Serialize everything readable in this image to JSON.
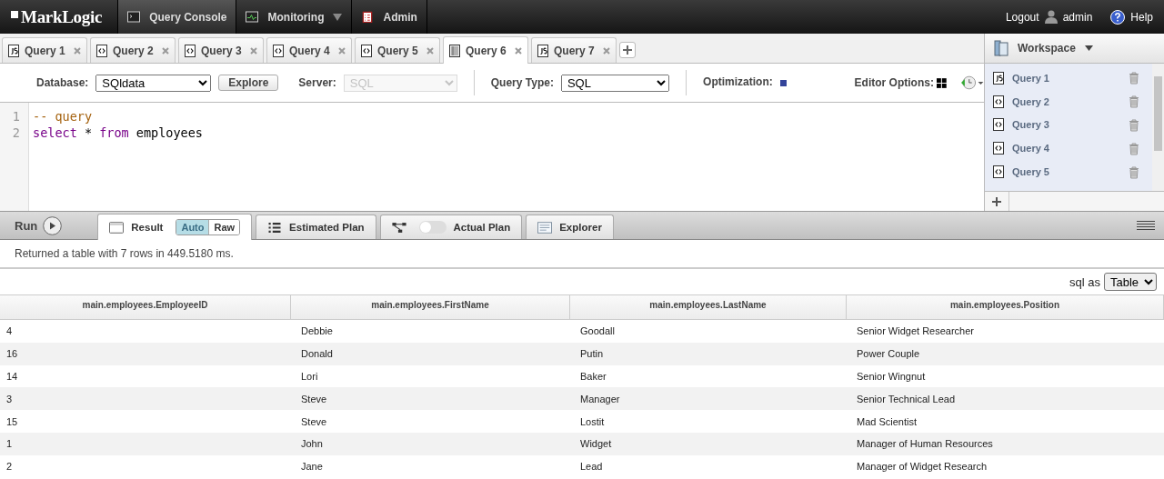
{
  "nav": {
    "logo": "MarkLogic",
    "items": [
      {
        "label": "Query Console",
        "selected": true,
        "dropdown": false
      },
      {
        "label": "Monitoring",
        "selected": false,
        "dropdown": true
      },
      {
        "label": "Admin",
        "selected": false,
        "dropdown": false
      }
    ],
    "logout": "Logout",
    "user": "admin",
    "help": "Help"
  },
  "query_tabs": [
    {
      "label": "Query 1",
      "kind": "js",
      "selected": false
    },
    {
      "label": "Query 2",
      "kind": "xquery",
      "selected": false
    },
    {
      "label": "Query 3",
      "kind": "xquery",
      "selected": false
    },
    {
      "label": "Query 4",
      "kind": "xquery",
      "selected": false
    },
    {
      "label": "Query 5",
      "kind": "xquery",
      "selected": false
    },
    {
      "label": "Query 6",
      "kind": "sql",
      "selected": true
    },
    {
      "label": "Query 7",
      "kind": "js",
      "selected": false
    }
  ],
  "toolbar": {
    "database": {
      "label": "Database:",
      "value": "SQldata"
    },
    "explore": "Explore",
    "server": {
      "label": "Server:",
      "value": "SQL",
      "disabled": true
    },
    "query_type": {
      "label": "Query Type:",
      "value": "SQL"
    },
    "optimization": {
      "label": "Optimization:"
    },
    "editor_options": {
      "label": "Editor Options:"
    }
  },
  "editor": {
    "lines": [
      {
        "number": "1",
        "tokens": [
          {
            "kind": "comment",
            "text": "-- query"
          }
        ]
      },
      {
        "number": "2",
        "tokens": [
          {
            "kind": "keyword",
            "text": "select"
          },
          {
            "kind": "plain",
            "text": " * "
          },
          {
            "kind": "keyword",
            "text": "from"
          },
          {
            "kind": "plain",
            "text": " employees"
          }
        ]
      }
    ]
  },
  "workspace": {
    "title": "Workspace",
    "items": [
      {
        "label": "Query 1",
        "kind": "js"
      },
      {
        "label": "Query 2",
        "kind": "xquery"
      },
      {
        "label": "Query 3",
        "kind": "xquery"
      },
      {
        "label": "Query 4",
        "kind": "xquery"
      },
      {
        "label": "Query 5",
        "kind": "xquery"
      }
    ]
  },
  "results": {
    "run": "Run",
    "tabs": [
      {
        "label": "Result",
        "kind": "result",
        "selected": true,
        "modes": [
          {
            "label": "Auto",
            "selected": true
          },
          {
            "label": "Raw",
            "selected": false
          }
        ]
      },
      {
        "label": "Estimated Plan",
        "kind": "estimated",
        "selected": false
      },
      {
        "label": "Actual Plan",
        "kind": "actual",
        "selected": false,
        "on": false
      },
      {
        "label": "Explorer",
        "kind": "explorer",
        "selected": false
      }
    ],
    "status": "Returned a table with 7 rows in 449.5180 ms.",
    "format": {
      "label": "sql as",
      "value": "Table"
    },
    "table": {
      "columns": [
        "main.employees.EmployeeID",
        "main.employees.FirstName",
        "main.employees.LastName",
        "main.employees.Position"
      ],
      "rows": [
        [
          "4",
          "Debbie",
          "Goodall",
          "Senior Widget Researcher"
        ],
        [
          "16",
          "Donald",
          "Putin",
          "Power Couple"
        ],
        [
          "14",
          "Lori",
          "Baker",
          "Senior Wingnut"
        ],
        [
          "3",
          "Steve",
          "Manager",
          "Senior Technical Lead"
        ],
        [
          "15",
          "Steve",
          "Lostit",
          "Mad Scientist"
        ],
        [
          "1",
          "John",
          "Widget",
          "Manager of Human Resources"
        ],
        [
          "2",
          "Jane",
          "Lead",
          "Manager of Widget Research"
        ]
      ]
    }
  }
}
